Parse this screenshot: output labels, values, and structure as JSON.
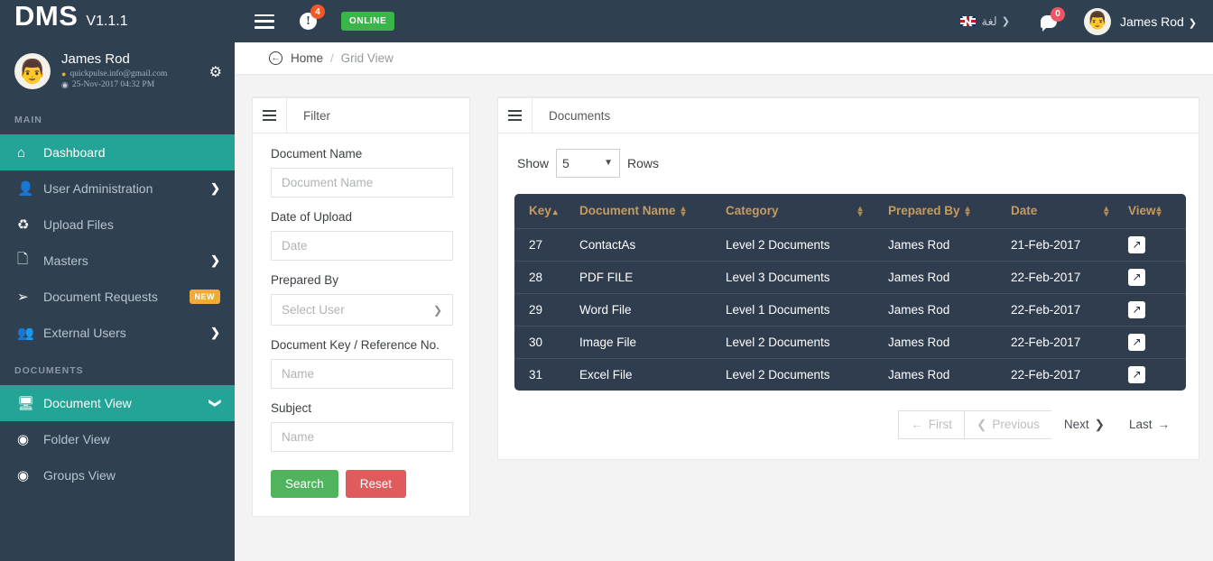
{
  "header": {
    "brand": "DMS",
    "version": "V1.1.1",
    "menu_icon": "hamburger-icon",
    "alert_icon": "exclamation-icon",
    "alert_count": "4",
    "status_pill": "ONLINE",
    "language_label": "لغة",
    "flag_icon": "uk-flag-icon",
    "chat_icon": "chat-bubble-icon",
    "chat_count": "0",
    "user_name": "James Rod",
    "user_avatar_icon": "avatar-icon"
  },
  "profile": {
    "name": "James Rod",
    "email": "quickpulse.info@gmail.com",
    "last_login": "25-Nov-2017 04:32 PM",
    "settings_icon": "gear-icon",
    "location_icon": "pin-icon",
    "time_icon": "clock-icon"
  },
  "sidebar": {
    "sections": [
      {
        "title": "MAIN",
        "items": [
          {
            "label": "Dashboard",
            "icon": "home-icon",
            "active": true,
            "caret": "",
            "badge": ""
          },
          {
            "label": "User Administration",
            "icon": "user-icon",
            "active": false,
            "caret": "❯",
            "badge": ""
          },
          {
            "label": "Upload Files",
            "icon": "recycle-icon",
            "active": false,
            "caret": "",
            "badge": ""
          },
          {
            "label": "Masters",
            "icon": "file-icon",
            "active": false,
            "caret": "❯",
            "badge": ""
          },
          {
            "label": "Document Requests",
            "icon": "export-icon",
            "active": false,
            "caret": "",
            "badge": "NEW"
          },
          {
            "label": "External Users",
            "icon": "user-shared-icon",
            "active": false,
            "caret": "❯",
            "badge": ""
          }
        ]
      },
      {
        "title": "DOCUMENTS",
        "items": [
          {
            "label": "Document View",
            "icon": "monitor-icon",
            "active": true,
            "caret": "❯",
            "badge": ""
          },
          {
            "label": "Folder View",
            "icon": "circle-dot-icon",
            "active": false,
            "caret": "",
            "badge": ""
          },
          {
            "label": "Groups View",
            "icon": "circle-dot-icon",
            "active": false,
            "caret": "",
            "badge": ""
          }
        ]
      }
    ]
  },
  "breadcrumb": {
    "icon": "back-circle-icon",
    "home": "Home",
    "separator": "/",
    "current": "Grid View"
  },
  "filter": {
    "panel_title": "Filter",
    "panel_icon": "hamburger-icon",
    "fields": [
      {
        "label": "Document Name",
        "placeholder": "Document Name",
        "type": "text",
        "value": ""
      },
      {
        "label": "Date of Upload",
        "placeholder": "Date",
        "type": "text",
        "value": ""
      },
      {
        "label": "Prepared By",
        "placeholder": "Select User",
        "type": "select",
        "value": "Select User"
      },
      {
        "label": "Document Key / Reference No.",
        "placeholder": "Name",
        "type": "text",
        "value": ""
      },
      {
        "label": "Subject",
        "placeholder": "Name",
        "type": "text",
        "value": ""
      }
    ],
    "search_label": "Search",
    "reset_label": "Reset"
  },
  "documents": {
    "panel_title": "Documents",
    "panel_icon": "hamburger-icon",
    "show_prefix": "Show",
    "show_value": "5",
    "show_suffix": "Rows",
    "columns": [
      {
        "label": "Key",
        "sort": "asc"
      },
      {
        "label": "Document Name",
        "sort": "both"
      },
      {
        "label": "Category",
        "sort": "both"
      },
      {
        "label": "Prepared By",
        "sort": "both"
      },
      {
        "label": "Date",
        "sort": "both"
      },
      {
        "label": "View",
        "sort": "both"
      }
    ],
    "rows": [
      {
        "key": "27",
        "name": "ContactAs",
        "category": "Level 2 Documents",
        "prepared_by": "James Rod",
        "date": "21-Feb-2017",
        "view_icon": "external-link-icon"
      },
      {
        "key": "28",
        "name": "PDF FILE",
        "category": "Level 3 Documents",
        "prepared_by": "James Rod",
        "date": "22-Feb-2017",
        "view_icon": "external-link-icon"
      },
      {
        "key": "29",
        "name": "Word File",
        "category": "Level 1 Documents",
        "prepared_by": "James Rod",
        "date": "22-Feb-2017",
        "view_icon": "external-link-icon"
      },
      {
        "key": "30",
        "name": "Image File",
        "category": "Level 2 Documents",
        "prepared_by": "James Rod",
        "date": "22-Feb-2017",
        "view_icon": "external-link-icon"
      },
      {
        "key": "31",
        "name": "Excel File",
        "category": "Level 2 Documents",
        "prepared_by": "James Rod",
        "date": "22-Feb-2017",
        "view_icon": "external-link-icon"
      }
    ],
    "pagination": [
      {
        "label": "First",
        "icon_before": "←",
        "icon_after": "",
        "disabled": true
      },
      {
        "label": "Previous",
        "icon_before": "❮",
        "icon_after": "",
        "disabled": true
      },
      {
        "label": "Next",
        "icon_before": "",
        "icon_after": "❯",
        "disabled": false
      },
      {
        "label": "Last",
        "icon_before": "",
        "icon_after": "→",
        "disabled": false
      }
    ]
  },
  "colors": {
    "sidebar_bg": "#2f4050",
    "accent_teal": "#24a397",
    "table_header_bg": "#2f3d4f",
    "table_header_text": "#c79b5e",
    "badge_new": "#f0a93b",
    "online_green": "#39b54a",
    "search_green": "#4fb45d",
    "reset_red": "#e05c5c",
    "alert_badge": "#f05a28"
  }
}
